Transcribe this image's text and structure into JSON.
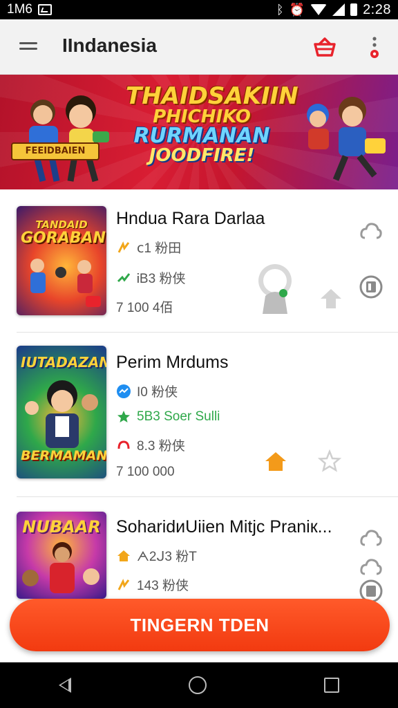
{
  "status_bar": {
    "left_text": "1M6",
    "time": "2:28"
  },
  "app_bar": {
    "title": "IIndanesia"
  },
  "banner": {
    "lines": [
      "THAIDSAKIIN",
      "PHICHIKO",
      "RURMANAN",
      "JOODFIRE!"
    ],
    "badge": "FEEIDBAIEN"
  },
  "colors": {
    "accent": "#f23a10",
    "banner_red": "#d91d33",
    "appbar_bg": "#f2f2f2"
  },
  "games": [
    {
      "title": "Hndua Rara Darlaa",
      "thumb_text": [
        "TANDAID",
        "GORABAN"
      ],
      "stats": [
        "ⅽ1 粉田",
        "ᎥB3 粉侠",
        "7 100 4佰"
      ]
    },
    {
      "title": "Perim Mrdums",
      "thumb_text": [
        "IUTADAZAN",
        "BERMAMAN"
      ],
      "stats": [
        "I0 粉侠",
        "5B3 Soer Sulli",
        "8.3 粉侠",
        "7 100 000"
      ]
    },
    {
      "title": "SoharidиUiien Mitjc Praniк...",
      "thumb_text": [
        "NUBAAR"
      ],
      "stats": [
        "ᗅ2ᒍ3 粉T",
        "143 粉侠"
      ]
    }
  ],
  "cta": {
    "label": "TINGERN TDEN"
  }
}
